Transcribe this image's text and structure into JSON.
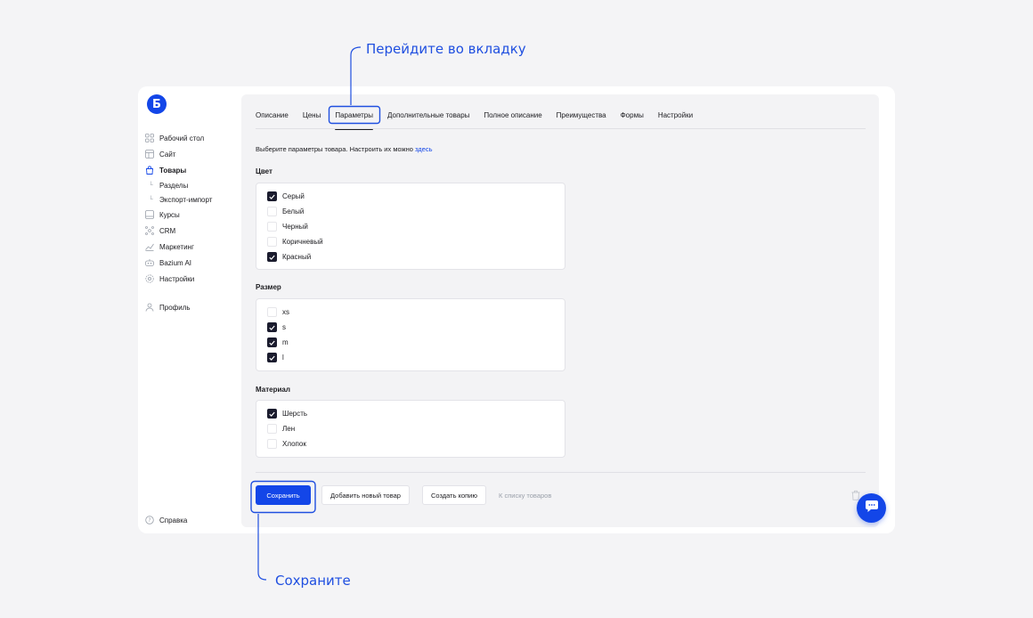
{
  "annotations": {
    "top": "Перейдите во вкладку",
    "bottom": "Сохраните"
  },
  "logo": {
    "letter": "Б",
    "icon": "brand-logo"
  },
  "sidebar": {
    "items": [
      {
        "label": "Рабочий стол",
        "icon": "grid-icon"
      },
      {
        "label": "Сайт",
        "icon": "layout-icon"
      },
      {
        "label": "Товары",
        "icon": "shopping-bag-icon",
        "active": true
      },
      {
        "label": "Курсы",
        "icon": "book-icon"
      },
      {
        "label": "CRM",
        "icon": "network-icon"
      },
      {
        "label": "Маркетинг",
        "icon": "chart-icon"
      },
      {
        "label": "Bazium AI",
        "icon": "ai-icon"
      },
      {
        "label": "Настройки",
        "icon": "gear-icon"
      },
      {
        "label": "Профиль",
        "icon": "user-icon"
      }
    ],
    "subitems": [
      {
        "label": "Разделы"
      },
      {
        "label": "Экспорт-импорт"
      }
    ],
    "help": "Справка"
  },
  "tabs": [
    {
      "label": "Описание"
    },
    {
      "label": "Цены"
    },
    {
      "label": "Параметры",
      "active": true
    },
    {
      "label": "Дополнительные товары"
    },
    {
      "label": "Полное описание"
    },
    {
      "label": "Преимущества"
    },
    {
      "label": "Формы"
    },
    {
      "label": "Настройки"
    }
  ],
  "hint": {
    "text": "Выберите параметры товара. Настроить их можно ",
    "link": "здесь"
  },
  "groups": {
    "color": {
      "title": "Цвет",
      "options": [
        {
          "label": "Серый",
          "checked": true
        },
        {
          "label": "Белый",
          "checked": false
        },
        {
          "label": "Черный",
          "checked": false
        },
        {
          "label": "Коричневый",
          "checked": false
        },
        {
          "label": "Красный",
          "checked": true
        }
      ]
    },
    "size": {
      "title": "Размер",
      "options": [
        {
          "label": "xs",
          "checked": false
        },
        {
          "label": "s",
          "checked": true
        },
        {
          "label": "m",
          "checked": true
        },
        {
          "label": "l",
          "checked": true
        }
      ]
    },
    "material": {
      "title": "Материал",
      "options": [
        {
          "label": "Шерсть",
          "checked": true
        },
        {
          "label": "Лен",
          "checked": false
        },
        {
          "label": "Хлопок",
          "checked": false
        }
      ]
    }
  },
  "buttons": {
    "save": "Сохранить",
    "add_new": "Добавить новый товар",
    "copy": "Создать копию",
    "to_list": "К списку товаров"
  },
  "colors": {
    "accent": "#1346e8",
    "annotation": "#1f4fe0",
    "checkbox_checked": "#1b1c2e"
  }
}
